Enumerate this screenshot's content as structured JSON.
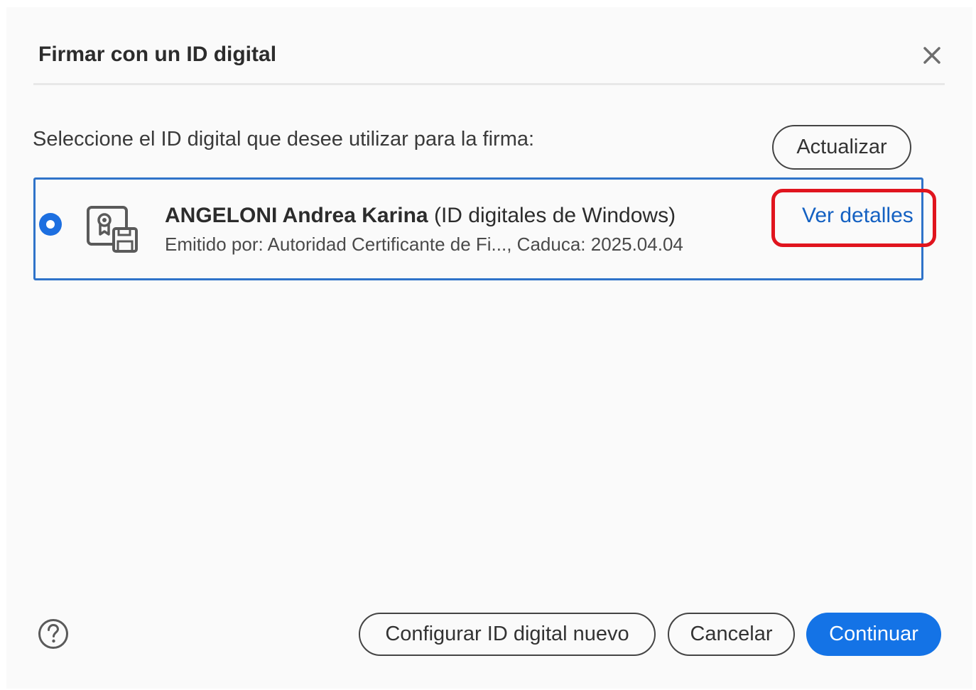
{
  "dialog": {
    "title": "Firmar con un ID digital",
    "close_icon": "close-icon"
  },
  "selection": {
    "prompt": "Seleccione el ID digital que desee utilizar para la firma:",
    "refresh_label": "Actualizar"
  },
  "digital_id": {
    "selected": true,
    "icon": "certificate-icon",
    "name": "ANGELONI Andrea Karina",
    "source": " (ID digitales de Windows)",
    "issuer_line": "Emitido por: Autoridad Certificante de Fi..., Caduca: 2025.04.04",
    "details_link": "Ver detalles"
  },
  "footer": {
    "help_icon": "help-icon",
    "setup_label": "Configurar ID digital nuevo",
    "cancel_label": "Cancelar",
    "continue_label": "Continuar"
  },
  "colors": {
    "accent": "#1473e6",
    "selection_border": "#2f73c9",
    "link": "#1461c2",
    "annotation": "#e0141e"
  }
}
